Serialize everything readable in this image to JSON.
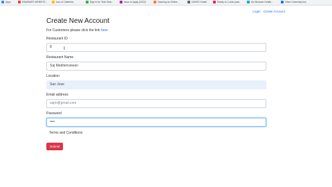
{
  "bookmarks": [
    {
      "label": "Apps",
      "color": "#4285f4"
    },
    {
      "label": "RAWMAPS WEBSITE...",
      "color": "#ea4335"
    },
    {
      "label": "Icon of Cafeteria..",
      "color": "#fbbc05"
    },
    {
      "label": "Sign in for Tech Sear...",
      "color": "#34a853"
    },
    {
      "label": "Issue to Apply (2022)",
      "color": "#9c27b0"
    },
    {
      "label": "Opening an Online...",
      "color": "#ff7043"
    },
    {
      "label": "UW/HC Hostel",
      "color": "#5f6368"
    },
    {
      "label": "Ready to 1-click pass",
      "color": "#e91e63"
    },
    {
      "label": "Arc Browser Health...",
      "color": "#00acc1"
    },
    {
      "label": "Other University bus",
      "color": "#1a73e8"
    }
  ],
  "nav": {
    "login": "Login",
    "create_account": "Create Account"
  },
  "form": {
    "title": "Create New Account",
    "subtitle_text": "For Customers please click the link",
    "subtitle_link": "here",
    "restaurant_id": {
      "label": "Restaurant ID",
      "value": "8"
    },
    "restaurant_name": {
      "label": "Restaurant Name",
      "value": "Saj Mediterranean"
    },
    "location": {
      "label": "Location",
      "value": "San Jose"
    },
    "email": {
      "label": "Email address",
      "value": "sajm@gmail.com"
    },
    "password": {
      "label": "Password",
      "value": "••••"
    },
    "terms": "Terms and Conditions",
    "submit": "Submit"
  },
  "colors": {
    "link": "#1a73e8",
    "submit_bg": "#dc3545",
    "autofill_bg": "#e8f0fe",
    "focus_border": "#80bdff"
  },
  "icons": {
    "text_cursor": "I-beam"
  }
}
